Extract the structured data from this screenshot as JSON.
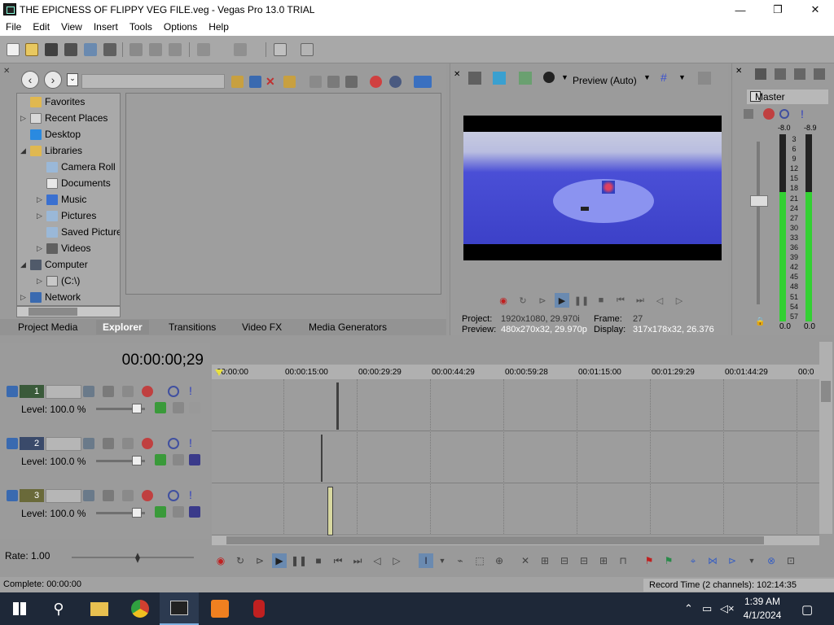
{
  "window": {
    "title": "THE EPICNESS OF FLIPPY VEG FILE.veg - Vegas Pro 13.0 TRIAL",
    "minimize": "—",
    "maximize": "❐",
    "close": "✕"
  },
  "menu": {
    "items": [
      "File",
      "Edit",
      "View",
      "Insert",
      "Tools",
      "Options",
      "Help"
    ]
  },
  "explorer": {
    "path_value": "",
    "tree": [
      {
        "label": "Favorites",
        "icon": "folder-icon",
        "arrow": ""
      },
      {
        "label": "Recent Places",
        "icon": "recent-places-icon",
        "arrow": "▷"
      },
      {
        "label": "Desktop",
        "icon": "desktop-icon",
        "arrow": ""
      },
      {
        "label": "Libraries",
        "icon": "folder-icon",
        "arrow": "◢"
      },
      {
        "label": "Camera Roll",
        "icon": "pictures-icon",
        "arrow": ""
      },
      {
        "label": "Documents",
        "icon": "documents-icon",
        "arrow": ""
      },
      {
        "label": "Music",
        "icon": "music-icon",
        "arrow": "▷"
      },
      {
        "label": "Pictures",
        "icon": "pictures-icon",
        "arrow": "▷"
      },
      {
        "label": "Saved Pictures",
        "icon": "pictures-icon",
        "arrow": ""
      },
      {
        "label": "Videos",
        "icon": "videos-icon",
        "arrow": "▷"
      },
      {
        "label": "Computer",
        "icon": "computer-icon",
        "arrow": "◢"
      },
      {
        "label": "(C:\\)",
        "icon": "drive-icon",
        "arrow": "▷"
      },
      {
        "label": "Network",
        "icon": "network-icon",
        "arrow": "▷"
      }
    ],
    "tabs": [
      "Project Media",
      "Explorer",
      "Transitions",
      "Video FX",
      "Media Generators"
    ],
    "active_tab": "Explorer"
  },
  "preview": {
    "mode": "Preview (Auto)",
    "project_label": "Project:",
    "project_value": "1920x1080, 29.970i",
    "frame_label": "Frame:",
    "frame_value": "27",
    "preview_label": "Preview:",
    "preview_value": "480x270x32, 29.970p",
    "display_label": "Display:",
    "display_value": "317x178x32, 26.376"
  },
  "master": {
    "title": "Master",
    "peak_left": "-8.0",
    "peak_right": "-8.9",
    "scale": [
      "3",
      "6",
      "9",
      "12",
      "15",
      "18",
      "21",
      "24",
      "27",
      "30",
      "33",
      "36",
      "39",
      "42",
      "45",
      "48",
      "51",
      "54",
      "57"
    ],
    "gain_left": "0.0",
    "gain_right": "0.0",
    "level_left": 0.69,
    "level_right": 0.69
  },
  "timeline": {
    "time": "00:00:00;29",
    "ruler": [
      "00:00:00",
      "00:00:15:00",
      "00:00:29:29",
      "00:00:44:29",
      "00:00:59:28",
      "00:01:15:00",
      "00:01:29:29",
      "00:01:44:29",
      "00:0"
    ],
    "tracks": [
      {
        "number": "1",
        "level": "Level: 100.0 %"
      },
      {
        "number": "2",
        "level": "Level: 100.0 %"
      },
      {
        "number": "3",
        "level": "Level: 100.0 %"
      }
    ],
    "rate": "Rate: 1.00"
  },
  "status": {
    "complete": "Complete: 00:00:00",
    "record_time": "Record Time (2 channels): 102:14:35"
  },
  "taskbar": {
    "time": "1:39 AM",
    "date": "4/1/2024"
  },
  "colors": {
    "accent": "#3a7bd5",
    "meter_green": "#33d033",
    "video_blue": "#3c41c8"
  }
}
